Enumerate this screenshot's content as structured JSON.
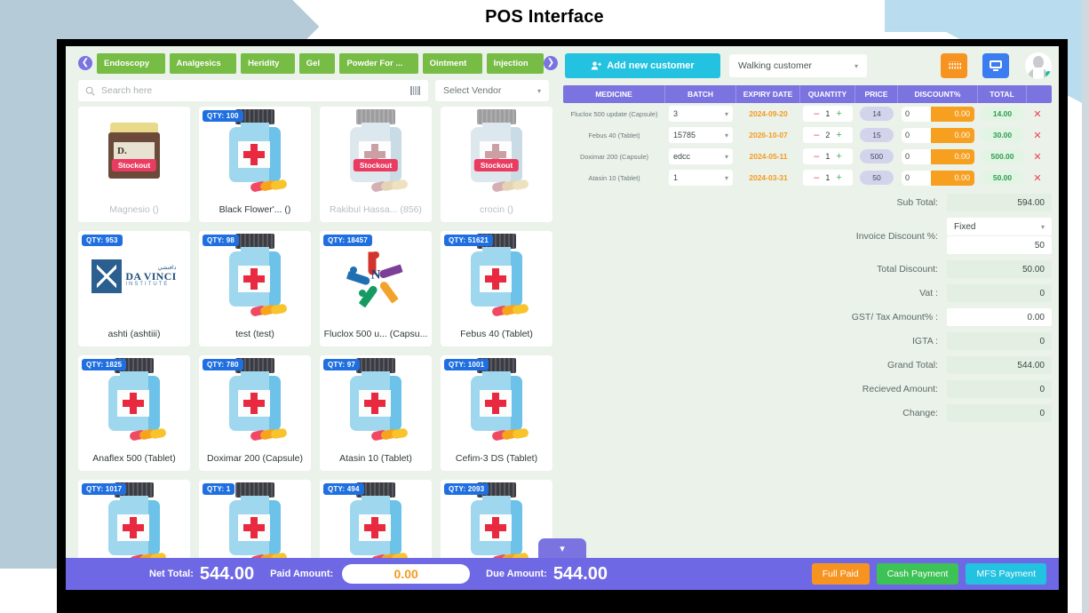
{
  "page": {
    "title": "POS Interface"
  },
  "categories": {
    "prev_icon": "chevron-left-icon",
    "next_icon": "chevron-right-icon",
    "items": [
      {
        "label": "Endoscopy"
      },
      {
        "label": "Analgesics"
      },
      {
        "label": "Heridity"
      },
      {
        "label": "Gel"
      },
      {
        "label": "Powder For ..."
      },
      {
        "label": "Ointment"
      },
      {
        "label": "Injection"
      }
    ]
  },
  "search": {
    "placeholder": "Search here",
    "value": "",
    "search_icon": "search-icon",
    "barcode_icon": "barcode-icon"
  },
  "vendor": {
    "label": "Select Vendor",
    "chevron": "⌄"
  },
  "customer": {
    "add_button": "Add new customer",
    "add_icon": "add-user-icon",
    "selected": "Walking customer",
    "chevron": "⌄",
    "keyboard_icon": "keyboard-icon",
    "monitor_icon": "monitor-icon",
    "avatar_icon": "user-avatar-icon"
  },
  "products": [
    {
      "name": "Magnesio ()",
      "qty": null,
      "stockout": true,
      "art": "jar"
    },
    {
      "name": "Black Flower'... ()",
      "qty": "QTY: 100",
      "stockout": false,
      "art": "bottle"
    },
    {
      "name": "Rakibul Hassa... (856)",
      "qty": null,
      "stockout": true,
      "art": "bottle"
    },
    {
      "name": "crocin ()",
      "qty": null,
      "stockout": true,
      "art": "bottle"
    },
    {
      "name": "ashti (ashtiii)",
      "qty": "QTY: 953",
      "stockout": false,
      "art": "davinci"
    },
    {
      "name": "test (test)",
      "qty": "QTY: 98",
      "stockout": false,
      "art": "bottle"
    },
    {
      "name": "Fluclox 500 u... (Capsu...",
      "qty": "QTY: 18457",
      "stockout": false,
      "art": "nlogo"
    },
    {
      "name": "Febus 40 (Tablet)",
      "qty": "QTY: 51621",
      "stockout": false,
      "art": "bottle"
    },
    {
      "name": "Anaflex 500 (Tablet)",
      "qty": "QTY: 1825",
      "stockout": false,
      "art": "bottle"
    },
    {
      "name": "Doximar 200 (Capsule)",
      "qty": "QTY: 780",
      "stockout": false,
      "art": "bottle"
    },
    {
      "name": "Atasin 10 (Tablet)",
      "qty": "QTY: 97",
      "stockout": false,
      "art": "bottle"
    },
    {
      "name": "Cefim-3 DS (Tablet)",
      "qty": "QTY: 1001",
      "stockout": false,
      "art": "bottle"
    },
    {
      "name": "",
      "qty": "QTY: 1017",
      "stockout": false,
      "art": "bottle"
    },
    {
      "name": "",
      "qty": "QTY: 1",
      "stockout": false,
      "art": "bottle"
    },
    {
      "name": "",
      "qty": "QTY: 494",
      "stockout": false,
      "art": "bottle"
    },
    {
      "name": "",
      "qty": "QTY: 2093",
      "stockout": false,
      "art": "bottle"
    }
  ],
  "stockout_label": "Stockout",
  "cart": {
    "headers": [
      "MEDICINE",
      "BATCH",
      "EXPIRY DATE",
      "QUANTITY",
      "PRICE",
      "DISCOUNT%",
      "TOTAL",
      ""
    ],
    "rows": [
      {
        "medicine": "Fluclox 500 update (Capsule)",
        "batch": "3",
        "expiry": "2024-09-20",
        "qty": "1",
        "price": "14",
        "discount_input": "0",
        "discount_value": "0.00",
        "total": "14.00"
      },
      {
        "medicine": "Febus 40 (Tablet)",
        "batch": "15785",
        "expiry": "2026-10-07",
        "qty": "2",
        "price": "15",
        "discount_input": "0",
        "discount_value": "0.00",
        "total": "30.00"
      },
      {
        "medicine": "Doximar 200 (Capsule)",
        "batch": "edcc",
        "expiry": "2024-05-11",
        "qty": "1",
        "price": "500",
        "discount_input": "0",
        "discount_value": "0.00",
        "total": "500.00"
      },
      {
        "medicine": "Atasin 10 (Tablet)",
        "batch": "1",
        "expiry": "2024-03-31",
        "qty": "1",
        "price": "50",
        "discount_input": "0",
        "discount_value": "0.00",
        "total": "50.00"
      }
    ],
    "minus_icon": "–",
    "plus_icon": "+",
    "delete_icon": "✕"
  },
  "totals": {
    "sub_total_label": "Sub Total:",
    "sub_total_value": "594.00",
    "invoice_discount_label": "Invoice Discount %:",
    "invoice_discount_type": "Fixed",
    "invoice_discount_value": "50",
    "total_discount_label": "Total Discount:",
    "total_discount_value": "50.00",
    "vat_label": "Vat :",
    "vat_value": "0",
    "gst_label": "GST/ Tax Amount% :",
    "gst_value": "0.00",
    "igta_label": "IGTA :",
    "igta_value": "0",
    "grand_total_label": "Grand Total:",
    "grand_total_value": "544.00",
    "recieved_label": "Recieved Amount:",
    "recieved_value": "0",
    "change_label": "Change:",
    "change_value": "0"
  },
  "collapse": {
    "icon": "chevron-down-icon"
  },
  "footer": {
    "net_total_label": "Net Total:",
    "net_total_value": "544.00",
    "paid_amount_label": "Paid Amount:",
    "paid_amount_value": "0.00",
    "due_amount_label": "Due Amount:",
    "due_amount_value": "544.00",
    "full_paid": "Full Paid",
    "cash_payment": "Cash Payment",
    "mfs_payment": "MFS Payment"
  },
  "colors": {
    "category_green": "#77bc45",
    "purple": "#7b73e0",
    "cyan": "#22c2e0",
    "orange": "#f79421",
    "green": "#3cc255",
    "expiry_orange": "#f59a1e",
    "total_green": "#2e9e4e",
    "delete_red": "#ef4056"
  }
}
